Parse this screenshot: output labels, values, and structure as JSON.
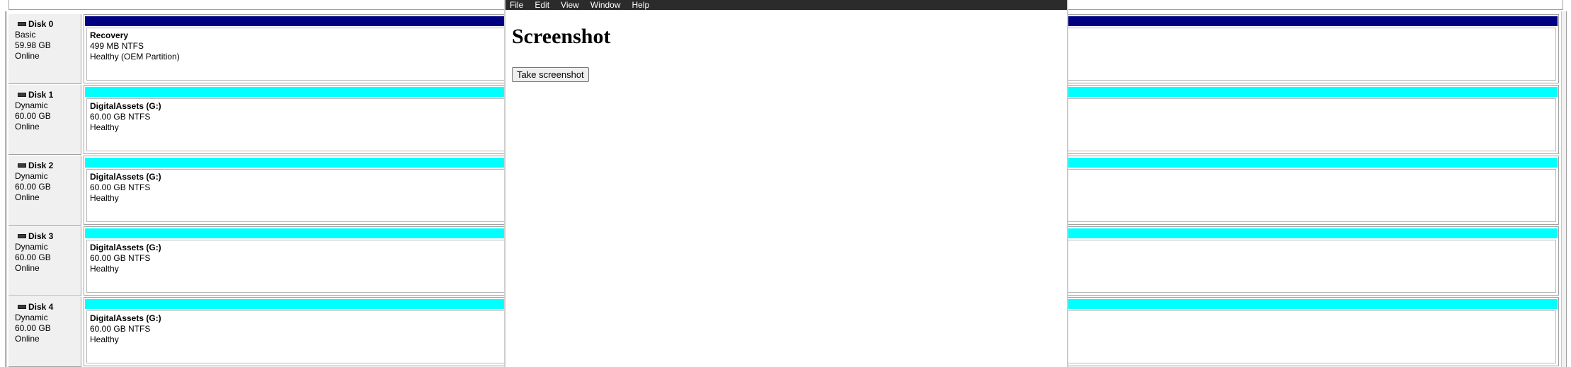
{
  "disks": [
    {
      "name": "Disk 0",
      "type": "Basic",
      "size": "59.98 GB",
      "status": "Online",
      "partition": {
        "name": "Recovery",
        "detail": "499 MB NTFS",
        "health": "Healthy (OEM Partition)",
        "bar_color": "#000080"
      }
    },
    {
      "name": "Disk 1",
      "type": "Dynamic",
      "size": "60.00 GB",
      "status": "Online",
      "partition": {
        "name": "DigitalAssets  (G:)",
        "detail": "60.00 GB NTFS",
        "health": "Healthy",
        "bar_color": "#00ffff"
      }
    },
    {
      "name": "Disk 2",
      "type": "Dynamic",
      "size": "60.00 GB",
      "status": "Online",
      "partition": {
        "name": "DigitalAssets  (G:)",
        "detail": "60.00 GB NTFS",
        "health": "Healthy",
        "bar_color": "#00ffff"
      }
    },
    {
      "name": "Disk 3",
      "type": "Dynamic",
      "size": "60.00 GB",
      "status": "Online",
      "partition": {
        "name": "DigitalAssets  (G:)",
        "detail": "60.00 GB NTFS",
        "health": "Healthy",
        "bar_color": "#00ffff"
      }
    },
    {
      "name": "Disk 4",
      "type": "Dynamic",
      "size": "60.00 GB",
      "status": "Online",
      "partition": {
        "name": "DigitalAssets  (G:)",
        "detail": "60.00 GB NTFS",
        "health": "Healthy",
        "bar_color": "#00ffff"
      }
    }
  ],
  "app": {
    "menu": [
      "File",
      "Edit",
      "View",
      "Window",
      "Help"
    ],
    "title": "Screenshot",
    "button_label": "Take screenshot"
  },
  "icons": {
    "disk": "disk-drive-icon"
  }
}
